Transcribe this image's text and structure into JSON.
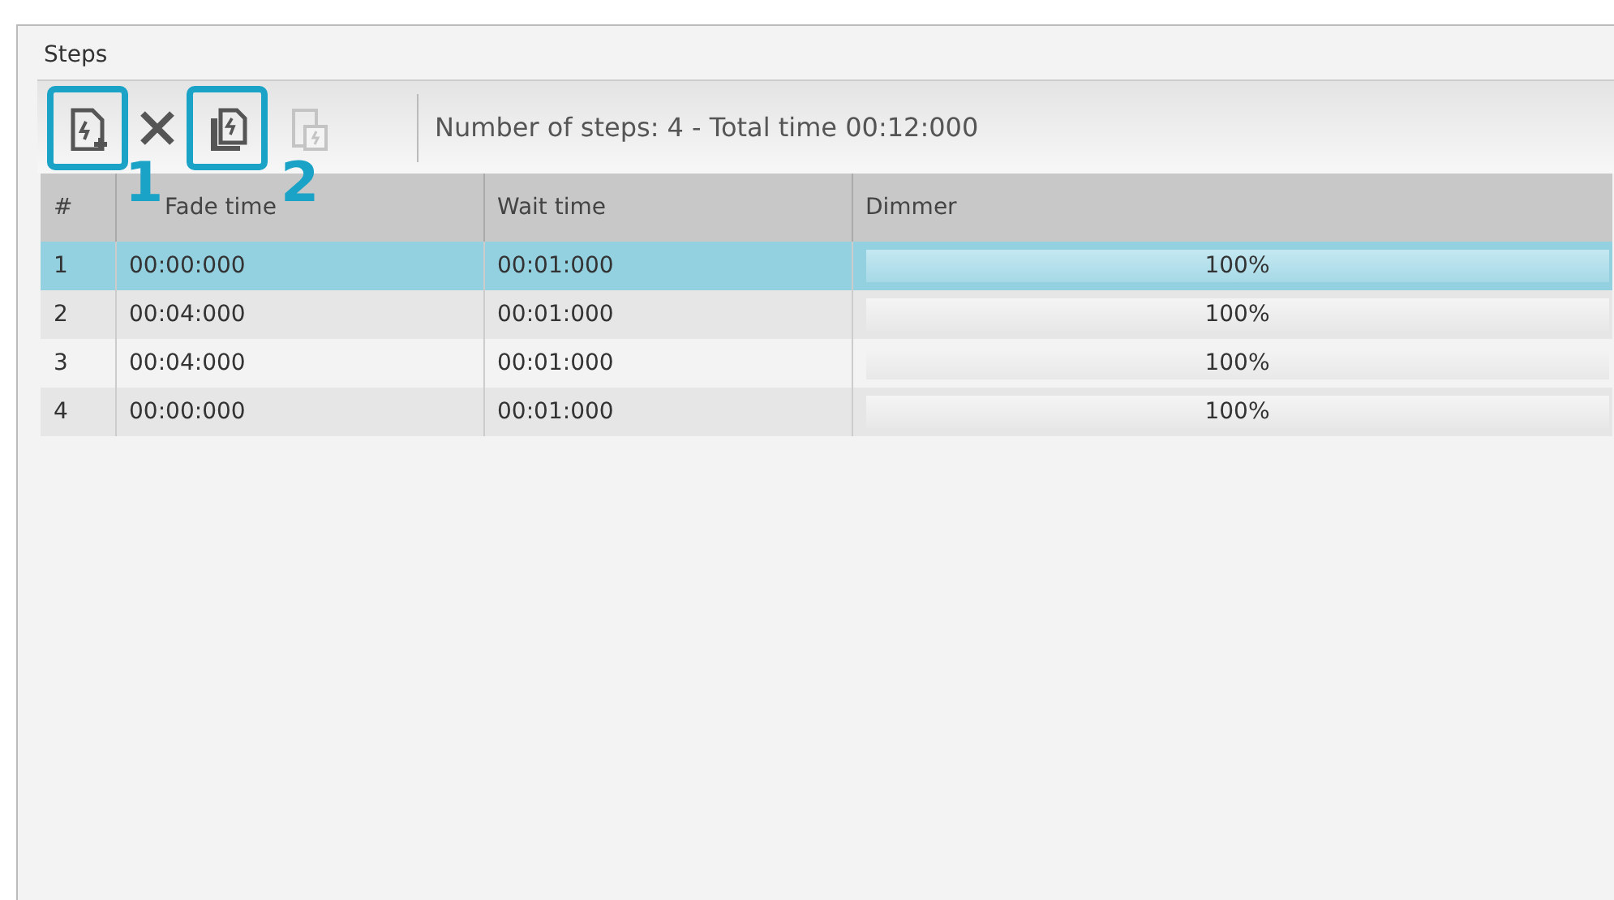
{
  "panel": {
    "title": "Steps"
  },
  "toolbar": {
    "buttons": [
      {
        "kind": "add",
        "disabled": false,
        "callout": "1"
      },
      {
        "kind": "remove",
        "disabled": false
      },
      {
        "kind": "clone",
        "disabled": false,
        "callout": "2"
      },
      {
        "kind": "paste",
        "disabled": true
      }
    ],
    "summary": "Number of steps: 4 - Total time 00:12:000"
  },
  "table": {
    "columns": [
      "#",
      "Fade time",
      "Wait time",
      "Dimmer"
    ],
    "rows": [
      {
        "number": "1",
        "fade_time": "00:00:000",
        "wait_time": "00:01:000",
        "dimmer": {
          "level": 1,
          "reading": "100%"
        },
        "selected": true
      },
      {
        "number": "2",
        "fade_time": "00:04:000",
        "wait_time": "00:01:000",
        "dimmer": {
          "level": 1,
          "reading": "100%"
        },
        "selected": false
      },
      {
        "number": "3",
        "fade_time": "00:04:000",
        "wait_time": "00:01:000",
        "dimmer": {
          "level": 1,
          "reading": "100%"
        },
        "selected": false
      },
      {
        "number": "4",
        "fade_time": "00:00:000",
        "wait_time": "00:01:000",
        "dimmer": {
          "level": 1,
          "reading": "100%"
        },
        "selected": false
      }
    ]
  }
}
